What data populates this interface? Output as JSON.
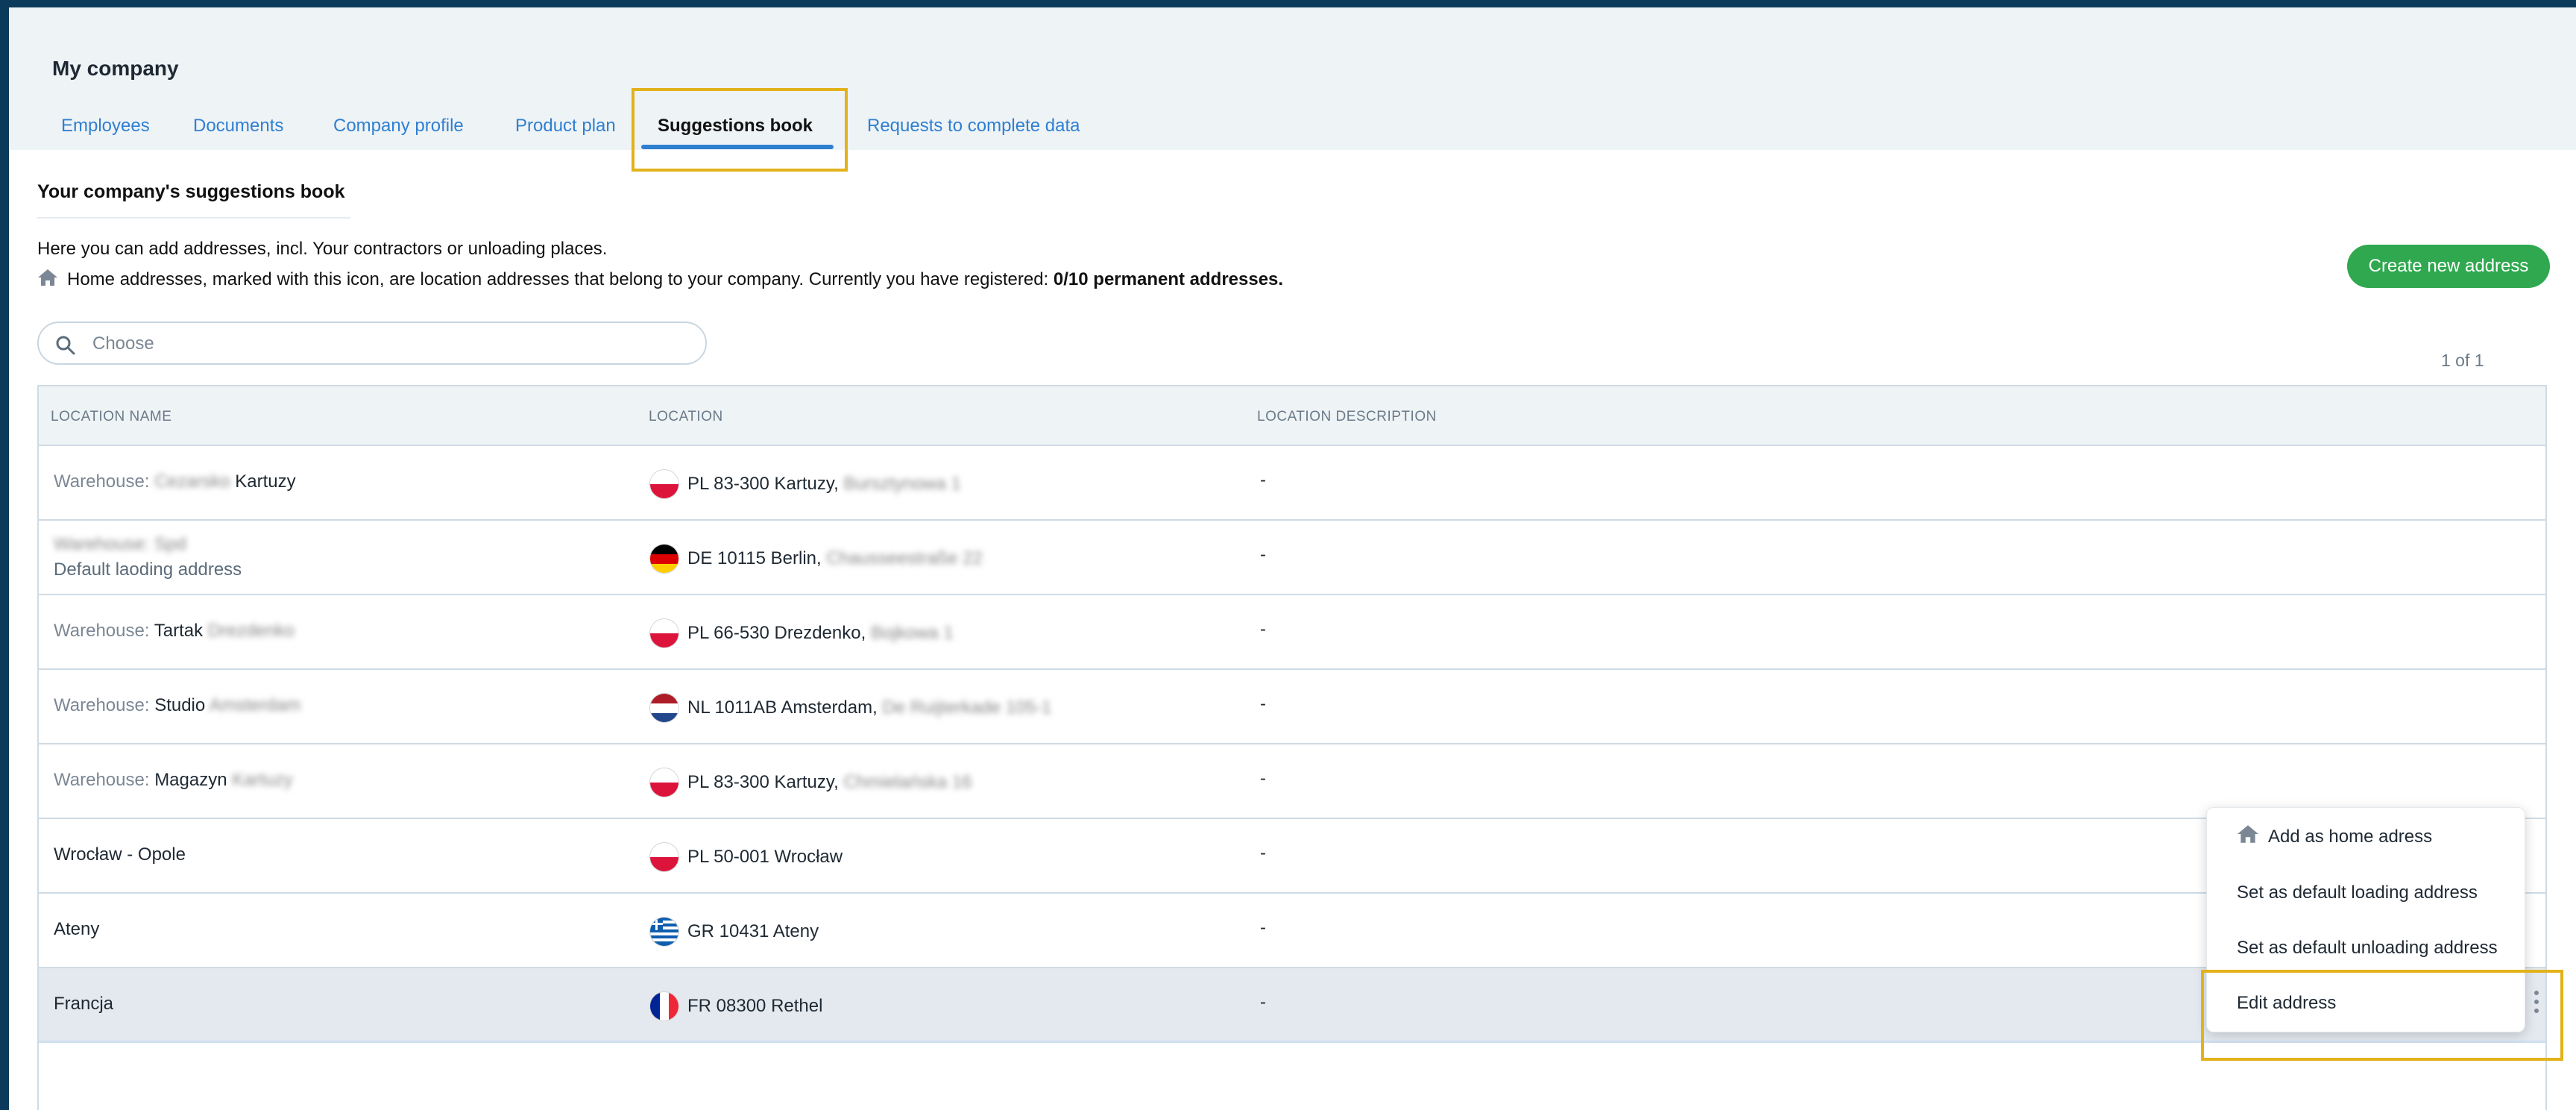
{
  "header": {
    "company_title": "My company"
  },
  "tabs": [
    {
      "label": "Employees"
    },
    {
      "label": "Documents"
    },
    {
      "label": "Company profile"
    },
    {
      "label": "Product plan"
    },
    {
      "label": "Suggestions book"
    },
    {
      "label": "Requests to complete data"
    }
  ],
  "active_tab": "Suggestions book",
  "section": {
    "title": "Your company's suggestions book",
    "info_line1": "Here you can add addresses, incl. Your contractors or unloading places.",
    "info_line2": "Home addresses, marked with this icon, are location addresses that belong to your company. Currently you have registered:",
    "permanent_count": "0/10 permanent addresses."
  },
  "create_button_label": "Create new address",
  "search": {
    "placeholder": "Choose",
    "value": ""
  },
  "pagination": "1 of 1",
  "table": {
    "headers": [
      "LOCATION NAME",
      "LOCATION",
      "LOCATION DESCRIPTION"
    ],
    "rows": [
      {
        "prefix": "Warehouse:",
        "blurred_a": "Cezarsko",
        "name": "Kartuzy",
        "blurred_b": "",
        "sub": "",
        "flag": "PL",
        "location": "PL 83-300 Kartuzy,",
        "location_blurred": "Bursztynowa 1",
        "description": "-"
      },
      {
        "prefix": "",
        "blurred_a": "Warehouse: Spd",
        "name": "",
        "blurred_b": "",
        "sub": "Default laoding address",
        "flag": "DE",
        "location": "DE 10115 Berlin,",
        "location_blurred": "Chausseestraße 22",
        "description": "-"
      },
      {
        "prefix": "Warehouse:",
        "blurred_a": "",
        "name": "Tartak",
        "blurred_b": "Drezdenko",
        "sub": "",
        "flag": "PL",
        "location": "PL 66-530 Drezdenko,",
        "location_blurred": "Bojkowa 1",
        "description": "-"
      },
      {
        "prefix": "Warehouse:",
        "blurred_a": "",
        "name": "Studio",
        "blurred_b": "Amsterdam",
        "sub": "",
        "flag": "NL",
        "location": "NL 1011AB Amsterdam,",
        "location_blurred": "De Ruijterkade 105-1",
        "description": "-"
      },
      {
        "prefix": "Warehouse:",
        "blurred_a": "",
        "name": "Magazyn",
        "blurred_b": "Kartuzy",
        "sub": "",
        "flag": "PL",
        "location": "PL 83-300 Kartuzy,",
        "location_blurred": "Chmielańska 16",
        "description": "-"
      },
      {
        "prefix": "",
        "blurred_a": "",
        "name": "Wrocław - Opole",
        "blurred_b": "",
        "sub": "",
        "flag": "PL",
        "location": "PL 50-001 Wrocław",
        "location_blurred": "",
        "description": "-"
      },
      {
        "prefix": "",
        "blurred_a": "",
        "name": "Ateny",
        "blurred_b": "",
        "sub": "",
        "flag": "GR",
        "location": "GR 10431 Ateny",
        "location_blurred": "",
        "description": "-"
      },
      {
        "prefix": "",
        "blurred_a": "",
        "name": "Francja",
        "blurred_b": "",
        "sub": "",
        "flag": "FR",
        "location": "FR 08300 Rethel",
        "location_blurred": "",
        "description": "-",
        "selected": true
      }
    ]
  },
  "context_menu": [
    {
      "label": "Add as home adress",
      "icon": "home-icon"
    },
    {
      "label": "Set as default loading address"
    },
    {
      "label": "Set as default unloading address"
    },
    {
      "label": "Edit address"
    }
  ],
  "colors": {
    "accent": "#2f7fd1",
    "create_button": "#2fa84f",
    "highlight": "#e2b21b"
  }
}
